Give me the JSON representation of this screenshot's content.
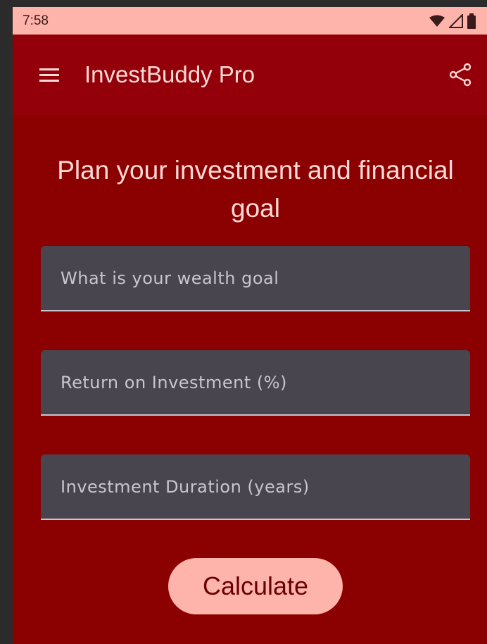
{
  "status_bar": {
    "time": "7:58",
    "icons": [
      "wifi-icon",
      "signal-icon",
      "battery-icon"
    ]
  },
  "app_bar": {
    "title": "InvestBuddy Pro",
    "menu_icon": "hamburger-menu-icon",
    "share_icon": "share-icon"
  },
  "main": {
    "heading": "Plan your investment and financial goal",
    "fields": {
      "wealth_goal": {
        "placeholder": "What is your wealth goal",
        "value": ""
      },
      "roi": {
        "placeholder": "Return on Investment (%)",
        "value": ""
      },
      "duration": {
        "placeholder": "Investment Duration (years)",
        "value": ""
      }
    },
    "calculate_label": "Calculate"
  },
  "colors": {
    "background": "#8b0000",
    "app_bar": "#93000a",
    "status_bar": "#ffb4ab",
    "field_bg": "#49454f",
    "button_bg": "#ffb4ab",
    "button_text": "#690005",
    "on_primary_text": "#ffdad6"
  }
}
